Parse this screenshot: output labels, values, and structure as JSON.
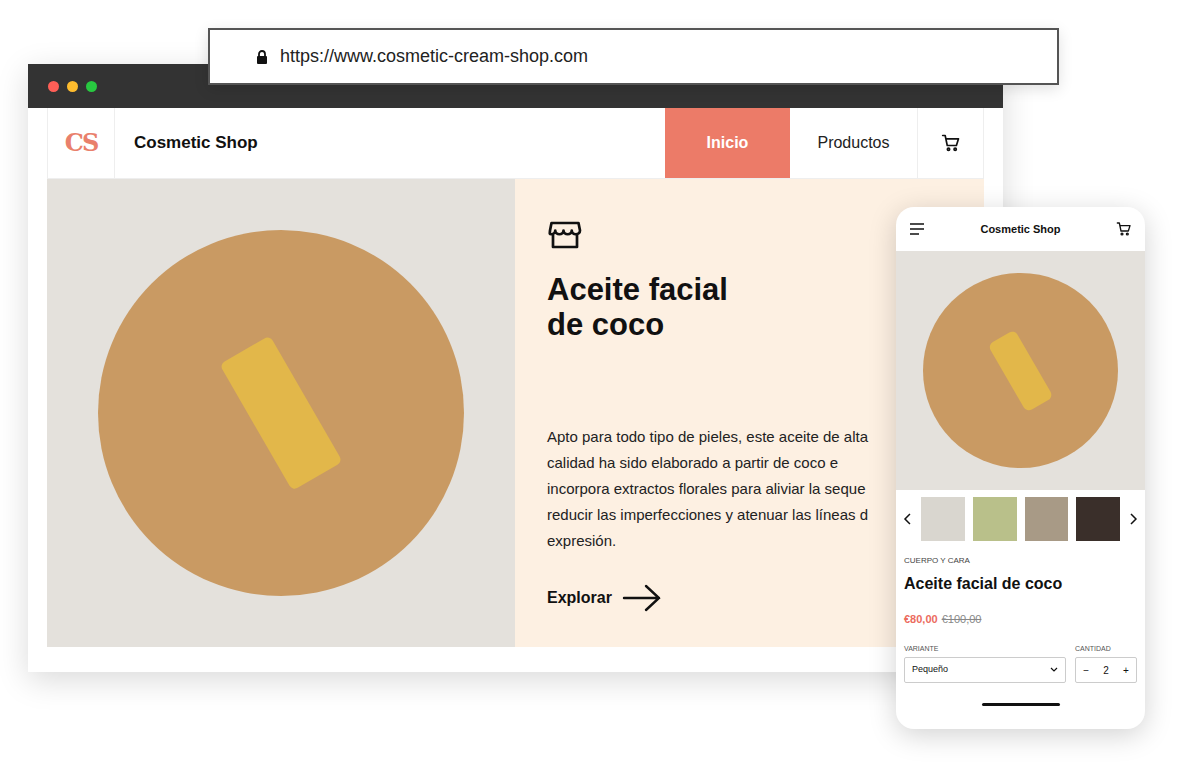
{
  "url_bar": {
    "url": "https://www.cosmetic-cream-shop.com"
  },
  "browser": {
    "traffic_lights": [
      {
        "color": "#ff5f57"
      },
      {
        "color": "#febc2e"
      },
      {
        "color": "#28c840"
      }
    ]
  },
  "nav": {
    "logo": "CS",
    "brand": "Cosmetic Shop",
    "items": [
      {
        "label": "Inicio",
        "selected": true
      },
      {
        "label": "Productos",
        "selected": false
      }
    ]
  },
  "hero": {
    "title_lines": [
      "Aceite facial",
      "de coco"
    ],
    "description_lines": [
      "Apto para todo tipo de pieles, este aceite de alta",
      "calidad ha sido elaborado a partir de coco e",
      "incorpora extractos florales para aliviar la seque",
      "reducir las imperfecciones y atenuar las líneas d",
      "expresión."
    ],
    "cta": "Explorar"
  },
  "phone": {
    "brand": "Cosmetic Shop",
    "thumbnails": [
      {
        "color": "#d9d6cf"
      },
      {
        "color": "#b9c08a"
      },
      {
        "color": "#a89a86"
      },
      {
        "color": "#3a2f2a"
      }
    ],
    "category": "CUERPO Y CARA",
    "product": "Aceite facial de coco",
    "price": "€80,00",
    "old_price": "€100,00",
    "variant": {
      "label": "VARIANTE",
      "value": "Pequeño"
    },
    "quantity": {
      "label": "CANTIDAD",
      "value": "2",
      "decrement": "−",
      "increment": "+"
    }
  }
}
